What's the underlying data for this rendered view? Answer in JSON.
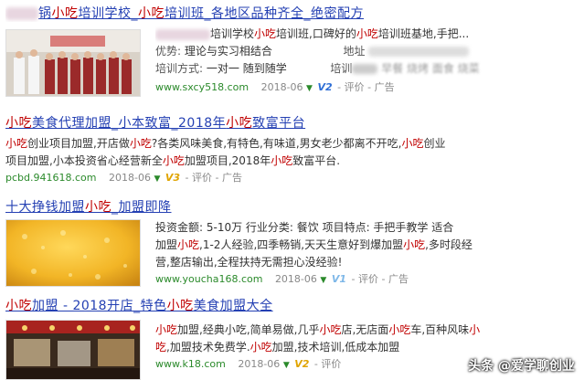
{
  "results": [
    {
      "title_parts": [
        {
          "t": "锅",
          "hl": false
        },
        {
          "t": "小吃",
          "hl": true
        },
        {
          "t": "培训学校_",
          "hl": false
        },
        {
          "t": "小吃",
          "hl": true
        },
        {
          "t": "培训班_各地区品种齐全_绝密配方",
          "hl": false
        }
      ],
      "line1": [
        "培训学校",
        "小吃",
        "培训班,口碑好的",
        "小吃",
        "培训班基地,手把..."
      ],
      "line2_label": "优势:",
      "line2_value": "理论与实习相结合",
      "line2_label2": "地址",
      "line3_label": "培训方式:",
      "line3_value": "一对一 随到随学",
      "line3_label2": "培训",
      "line3_value2": "早餐 烧烤 面食 烧菜",
      "url": "www.sxcy518.com",
      "date": "2018-06",
      "vlevel": "V2",
      "review": "评价",
      "ad": "广告"
    },
    {
      "title_parts": [
        {
          "t": "小吃",
          "hl": true
        },
        {
          "t": "美食代理加盟_小本致富_2018年",
          "hl": false
        },
        {
          "t": "小吃",
          "hl": true
        },
        {
          "t": "致富平台",
          "hl": false
        }
      ],
      "line1": [
        "小吃",
        "创业项目加盟,开店做",
        "小吃",
        "?各类风味美食,有特色,有味道,男女老少都离不开吃,",
        "小吃",
        "创业"
      ],
      "line2": [
        "项目加盟,小本投资省心经营新全",
        "小吃",
        "加盟项目,2018年",
        "小吃",
        "致富平台."
      ],
      "url": "pcbd.941618.com",
      "date": "2018-06",
      "vlevel": "V3",
      "review": "评价",
      "ad": "广告"
    },
    {
      "title_parts": [
        {
          "t": "十大挣钱加盟",
          "hl": false
        },
        {
          "t": "小吃",
          "hl": true
        },
        {
          "t": "_加盟即降",
          "hl": false
        }
      ],
      "line1": "投资金额: 5-10万   行业分类: 餐饮   项目特点: 手把手教学   适合",
      "line2": [
        "加盟",
        "小吃",
        ",1-2人经验,四季畅销,天天生意好到爆加盟",
        "小吃",
        ",多时段经"
      ],
      "line3": "营,整店输出,全程扶持无需担心没经验!",
      "url": "www.youcha168.com",
      "date": "2018-06",
      "vlevel": "V1",
      "review": "评价",
      "ad": "广告"
    },
    {
      "title_parts": [
        {
          "t": "小吃",
          "hl": true
        },
        {
          "t": "加盟 - 2018开店_特色",
          "hl": false
        },
        {
          "t": "小吃",
          "hl": true
        },
        {
          "t": "美食加盟大全",
          "hl": false
        }
      ],
      "line1": [
        "小吃",
        "加盟,经典小吃,简单易做,几乎",
        "小吃",
        "店,无店面",
        "小吃",
        "车,百种风味",
        "小"
      ],
      "line2": [
        "吃",
        ",加盟技术免费学.",
        "小吃",
        "加盟,技术培训,低成本加盟"
      ],
      "url": "www.k18.com",
      "date": "2018-06",
      "vlevel": "V2",
      "review": "评价",
      "ad": "广告"
    }
  ],
  "watermark": "头条 @爱学聊创业",
  "colors": {
    "link": "#2440b3",
    "highlight": "#c00000",
    "url": "#2b8a2b"
  }
}
